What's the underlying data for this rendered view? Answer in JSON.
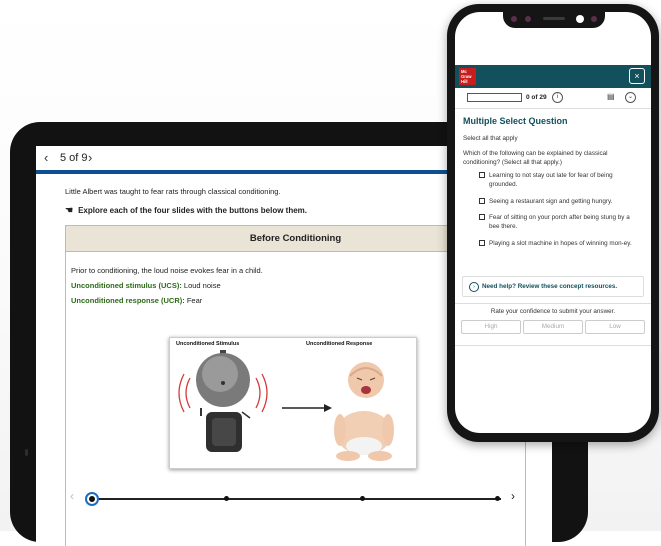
{
  "tablet": {
    "nav": {
      "prev_icon": "‹",
      "counter": "5 of 9",
      "next_icon": "›"
    },
    "intro": "Little Albert was taught to fear rats through classical conditioning.",
    "explore_icon": "hand-pointer",
    "explore": "Explore each of the four slides with the buttons below them.",
    "slide": {
      "title": "Before Conditioning",
      "line1": "Prior to conditioning, the loud noise evokes fear in a child.",
      "ucs_label": "Unconditioned stimulus (UCS):",
      "ucs_value": " Loud noise",
      "ucr_label": "Unconditioned response (UCR):",
      "ucr_value": " Fear",
      "figure": {
        "stimulus_label": "Unconditioned Stimulus",
        "response_label": "Unconditioned Response"
      }
    },
    "timeline": {
      "steps": 4,
      "current": 1,
      "prev_icon": "‹",
      "next_icon": "›"
    }
  },
  "phone": {
    "logo_lines": [
      "Mc",
      "Graw",
      "Hill"
    ],
    "close_icon": "×",
    "progress": {
      "count": "0 of 29",
      "info_icon": "i",
      "calendar_icon": "▤",
      "chevron_icon": "⌄"
    },
    "question": {
      "type_title": "Multiple Select Question",
      "instruction": "Select all that apply",
      "prompt": "Which of the following can be explained by classical conditioning? (Select all that apply.)",
      "options": [
        "Learning to not stay out late for fear of being grounded.",
        "Seeing a restaurant sign and getting hungry.",
        "Fear of sitting on your porch after being stung by a bee there.",
        "Playing a slot machine in hopes of winning mon-ey."
      ]
    },
    "help": {
      "icon": "›",
      "text": "Need help? Review these concept resources."
    },
    "confidence": {
      "title": "Rate your confidence to submit your answer.",
      "high": "High",
      "medium": "Medium",
      "low": "Low"
    }
  },
  "colors": {
    "header_teal": "#12505c",
    "tablet_bar_blue": "#0e4f94",
    "slide_header": "#e9e4d6",
    "label_green": "#2d6b19",
    "logo_red": "#c61d1d"
  }
}
